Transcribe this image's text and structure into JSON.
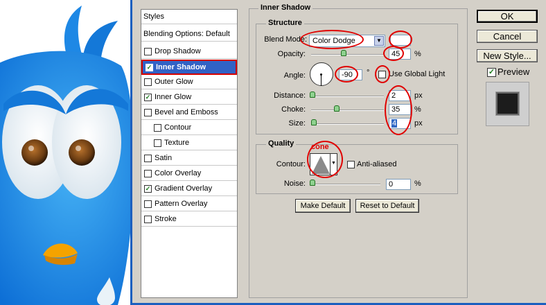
{
  "styles_panel": {
    "header": "Styles",
    "items": [
      {
        "label": "Blending Options: Default",
        "checkbox": false,
        "checked": false,
        "indent": false,
        "selected": false
      },
      {
        "label": "Drop Shadow",
        "checkbox": true,
        "checked": false,
        "indent": false,
        "selected": false
      },
      {
        "label": "Inner Shadow",
        "checkbox": true,
        "checked": true,
        "indent": false,
        "selected": true
      },
      {
        "label": "Outer Glow",
        "checkbox": true,
        "checked": false,
        "indent": false,
        "selected": false
      },
      {
        "label": "Inner Glow",
        "checkbox": true,
        "checked": true,
        "indent": false,
        "selected": false
      },
      {
        "label": "Bevel and Emboss",
        "checkbox": true,
        "checked": false,
        "indent": false,
        "selected": false
      },
      {
        "label": "Contour",
        "checkbox": true,
        "checked": false,
        "indent": true,
        "selected": false
      },
      {
        "label": "Texture",
        "checkbox": true,
        "checked": false,
        "indent": true,
        "selected": false
      },
      {
        "label": "Satin",
        "checkbox": true,
        "checked": false,
        "indent": false,
        "selected": false
      },
      {
        "label": "Color Overlay",
        "checkbox": true,
        "checked": false,
        "indent": false,
        "selected": false
      },
      {
        "label": "Gradient Overlay",
        "checkbox": true,
        "checked": true,
        "indent": false,
        "selected": false
      },
      {
        "label": "Pattern Overlay",
        "checkbox": true,
        "checked": false,
        "indent": false,
        "selected": false
      },
      {
        "label": "Stroke",
        "checkbox": true,
        "checked": false,
        "indent": false,
        "selected": false
      }
    ]
  },
  "inner_shadow": {
    "title": "Inner Shadow",
    "structure": {
      "title": "Structure",
      "blend_mode_label": "Blend Mode:",
      "blend_mode_value": "Color Dodge",
      "opacity_label": "Opacity:",
      "opacity_value": "45",
      "opacity_fraction": 0.45,
      "angle_label": "Angle:",
      "angle_value": "-90",
      "angle_unit": "°",
      "use_global_light_label": "Use Global Light",
      "use_global_light_checked": false,
      "distance_label": "Distance:",
      "distance_value": "2",
      "choke_label": "Choke:",
      "choke_value": "35",
      "choke_fraction": 0.35,
      "size_label": "Size:",
      "size_value": "4",
      "px_unit": "px",
      "percent_unit": "%"
    },
    "quality": {
      "title": "Quality",
      "contour_label": "Contour:",
      "contour_annotation": "cone",
      "anti_aliased_label": "Anti-aliased",
      "anti_aliased_checked": false,
      "noise_label": "Noise:",
      "noise_value": "0",
      "percent_unit": "%"
    },
    "make_default_label": "Make Default",
    "reset_to_default_label": "Reset to Default"
  },
  "right_buttons": {
    "ok_label": "OK",
    "cancel_label": "Cancel",
    "new_style_label": "New Style...",
    "preview_label": "Preview",
    "preview_checked": true
  },
  "colors": {
    "selected_row": "#3162c5",
    "annotation_red": "#e00000",
    "dialog_bg": "#d4d0c8",
    "bird_blue": "#1e88e5"
  }
}
